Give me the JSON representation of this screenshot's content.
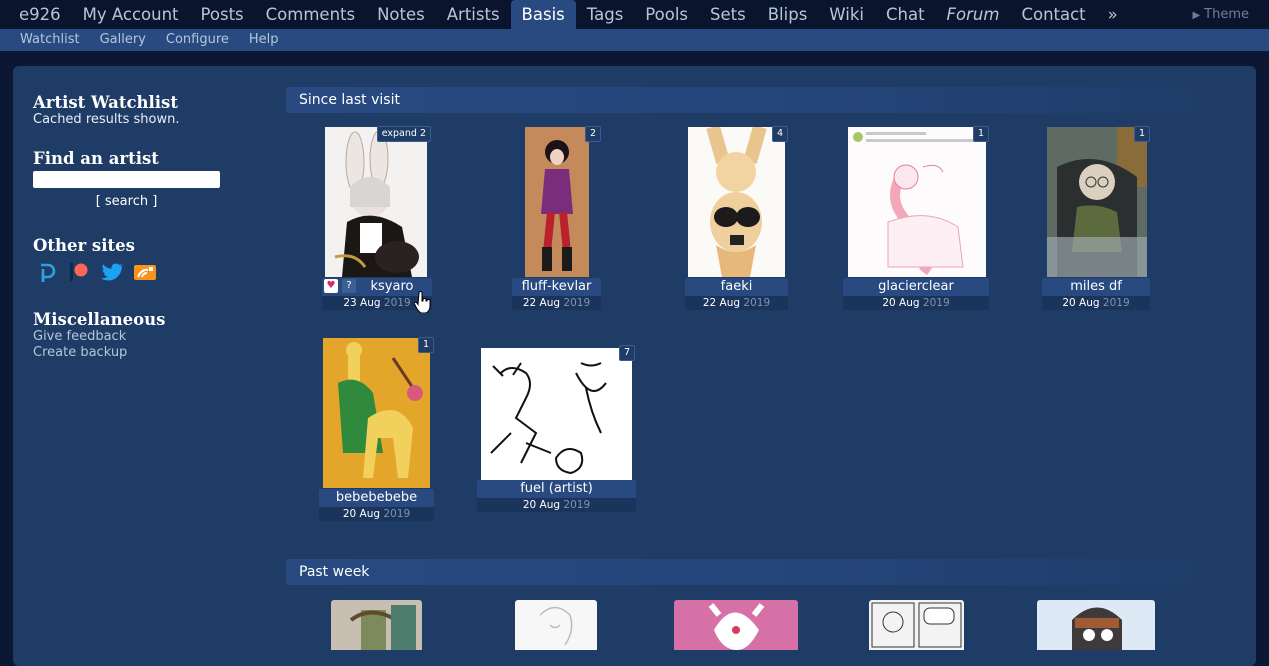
{
  "nav": {
    "items": [
      {
        "label": "e926"
      },
      {
        "label": "My Account"
      },
      {
        "label": "Posts"
      },
      {
        "label": "Comments"
      },
      {
        "label": "Notes"
      },
      {
        "label": "Artists"
      },
      {
        "label": "Basis",
        "active": true
      },
      {
        "label": "Tags"
      },
      {
        "label": "Pools"
      },
      {
        "label": "Sets"
      },
      {
        "label": "Blips"
      },
      {
        "label": "Wiki"
      },
      {
        "label": "Chat"
      },
      {
        "label": "Forum",
        "italic": true
      },
      {
        "label": "Contact"
      },
      {
        "label": "»"
      }
    ],
    "theme_label": "Theme"
  },
  "subnav": {
    "items": [
      "Watchlist",
      "Gallery",
      "Configure",
      "Help"
    ]
  },
  "sidebar": {
    "title": "Artist Watchlist",
    "subtitle": "Cached results shown.",
    "find_heading": "Find an artist",
    "search_value": "",
    "search_button": "[ search ]",
    "other_sites_heading": "Other sites",
    "other_sites": [
      "paheal-icon",
      "patreon-icon",
      "twitter-icon",
      "furaffinity-icon"
    ],
    "misc_heading": "Miscellaneous",
    "misc_links": [
      "Give feedback",
      "Create backup"
    ]
  },
  "sections": {
    "since_last_visit": "Since last visit",
    "past_week": "Past week"
  },
  "thumbs_since": [
    {
      "artist": "ksyaro",
      "date": "23 Aug",
      "year": "2019",
      "badge": "expand 2",
      "hovered": true,
      "heart_glyph": "♥",
      "question_glyph": "?"
    },
    {
      "artist": "fluff-kevlar",
      "date": "22 Aug",
      "year": "2019",
      "badge": "2"
    },
    {
      "artist": "faeki",
      "date": "22 Aug",
      "year": "2019",
      "badge": "4"
    },
    {
      "artist": "glacierclear",
      "date": "20 Aug",
      "year": "2019",
      "badge": "1"
    },
    {
      "artist": "miles df",
      "date": "20 Aug",
      "year": "2019",
      "badge": "1"
    },
    {
      "artist": "bebebebebe",
      "date": "20 Aug",
      "year": "2019",
      "badge": "1"
    },
    {
      "artist": "fuel (artist)",
      "date": "20 Aug",
      "year": "2019",
      "badge": "7"
    }
  ],
  "colors": {
    "background": "#0c1733",
    "panel": "#1f3c67",
    "accent": "#284a81",
    "link": "#b4c7d9"
  }
}
